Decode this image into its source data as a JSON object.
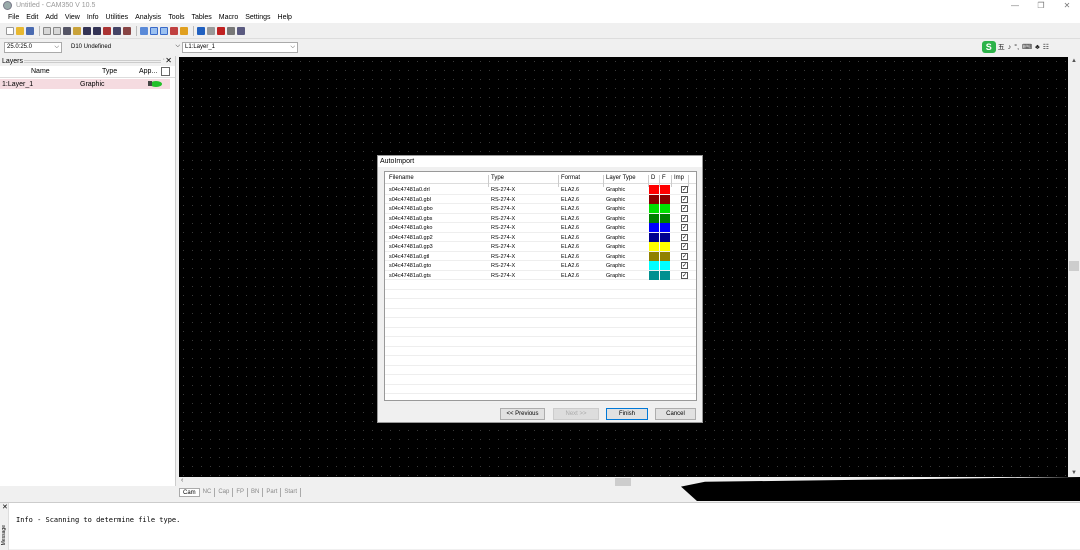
{
  "window": {
    "title": "Untitled - CAM350 V 10.5",
    "controls": [
      "—",
      "❐",
      "✕"
    ]
  },
  "menu": [
    "File",
    "Edit",
    "Add",
    "View",
    "Info",
    "Utilities",
    "Analysis",
    "Tools",
    "Tables",
    "Macro",
    "Settings",
    "Help"
  ],
  "combos": {
    "grid": "25.0:25.0",
    "dcode": "D10  Undefined",
    "layer": "L1:Layer_1"
  },
  "ime": {
    "logo": "S",
    "items": [
      "五",
      "♪",
      "°,",
      "⌨",
      "♣",
      "☷"
    ]
  },
  "layers": {
    "title": "Layers",
    "columns": {
      "name": "Name",
      "type": "Type",
      "app": "App..."
    },
    "rows": [
      {
        "name": "1:Layer_1",
        "type": "Graphic",
        "app_color": "#22c02a"
      }
    ]
  },
  "tabs": [
    "Cam",
    "NC",
    "Cap",
    "FP",
    "BN",
    "Part",
    "Start"
  ],
  "message": {
    "side_label": "Message",
    "text": "Info - Scanning to determine file type."
  },
  "dialog": {
    "title": "AutoImport",
    "columns": {
      "filename": "Filename",
      "type": "Type",
      "format": "Format",
      "layer_type": "Layer Type",
      "d": "D",
      "f": "F",
      "imp": "Imp"
    },
    "rows": [
      {
        "filename": "s04c47481a0.drl",
        "type": "RS-274-X",
        "format": "ELA2.6",
        "layer_type": "Graphic",
        "color": "#ff0000",
        "imp": "✓"
      },
      {
        "filename": "s04c47481a0.gbl",
        "type": "RS-274-X",
        "format": "ELA2.6",
        "layer_type": "Graphic",
        "color": "#8b0000",
        "imp": "✓"
      },
      {
        "filename": "s04c47481a0.gbo",
        "type": "RS-274-X",
        "format": "ELA2.6",
        "layer_type": "Graphic",
        "color": "#00e000",
        "imp": "✓"
      },
      {
        "filename": "s04c47481a0.gbs",
        "type": "RS-274-X",
        "format": "ELA2.6",
        "layer_type": "Graphic",
        "color": "#008000",
        "imp": "✓"
      },
      {
        "filename": "s04c47481a0.gko",
        "type": "RS-274-X",
        "format": "ELA2.6",
        "layer_type": "Graphic",
        "color": "#0000ff",
        "imp": "✓"
      },
      {
        "filename": "s04c47481a0.gp2",
        "type": "RS-274-X",
        "format": "ELA2.6",
        "layer_type": "Graphic",
        "color": "#000090",
        "imp": "✓"
      },
      {
        "filename": "s04c47481a0.gp3",
        "type": "RS-274-X",
        "format": "ELA2.6",
        "layer_type": "Graphic",
        "color": "#ffff00",
        "imp": "✓"
      },
      {
        "filename": "s04c47481a0.gtl",
        "type": "RS-274-X",
        "format": "ELA2.6",
        "layer_type": "Graphic",
        "color": "#908000",
        "imp": "✓"
      },
      {
        "filename": "s04c47481a0.gto",
        "type": "RS-274-X",
        "format": "ELA2.6",
        "layer_type": "Graphic",
        "color": "#00ffff",
        "imp": "✓"
      },
      {
        "filename": "s04c47481a0.gts",
        "type": "RS-274-X",
        "format": "ELA2.6",
        "layer_type": "Graphic",
        "color": "#009090",
        "imp": "✓"
      }
    ],
    "buttons": {
      "previous": "<< Previous",
      "next": "Next >>",
      "finish": "Finish",
      "cancel": "Cancel"
    }
  }
}
